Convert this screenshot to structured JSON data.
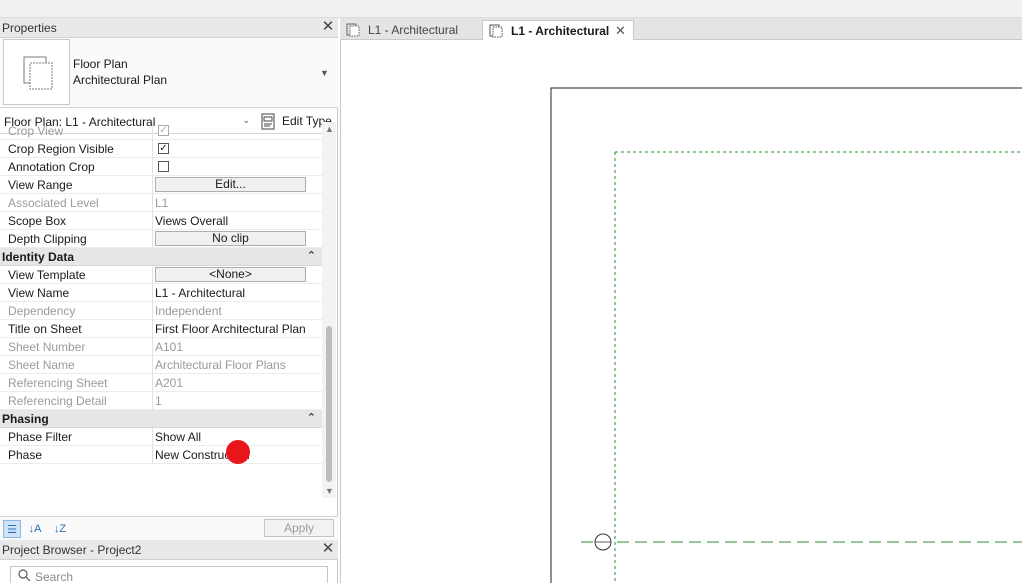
{
  "properties_panel": {
    "title": "Properties",
    "type_selector": {
      "family": "Floor Plan",
      "type": "Architectural Plan"
    },
    "instance_selector": "Floor Plan: L1 - Architectural",
    "edit_type_label": "Edit Type",
    "rows": {
      "crop_view": {
        "name": "Crop View"
      },
      "crop_region_visible": {
        "name": "Crop Region Visible"
      },
      "annotation_crop": {
        "name": "Annotation Crop"
      },
      "view_range": {
        "name": "View Range",
        "value": "Edit..."
      },
      "associated_level": {
        "name": "Associated Level",
        "value": "L1"
      },
      "scope_box": {
        "name": "Scope Box",
        "value": "Views Overall"
      },
      "depth_clipping": {
        "name": "Depth Clipping",
        "value": "No clip"
      },
      "view_template": {
        "name": "View Template",
        "value": "<None>"
      },
      "view_name": {
        "name": "View Name",
        "value": "L1 - Architectural"
      },
      "dependency": {
        "name": "Dependency",
        "value": "Independent"
      },
      "title_on_sheet": {
        "name": "Title on Sheet",
        "value": "First Floor Architectural Plan"
      },
      "sheet_number": {
        "name": "Sheet Number",
        "value": "A101"
      },
      "sheet_name": {
        "name": "Sheet Name",
        "value": "Architectural Floor Plans"
      },
      "referencing_sheet": {
        "name": "Referencing Sheet",
        "value": "A201"
      },
      "referencing_detail": {
        "name": "Referencing Detail",
        "value": "1"
      },
      "phase_filter": {
        "name": "Phase Filter",
        "value": "Show All"
      },
      "phase": {
        "name": "Phase",
        "value": "New Construction"
      }
    },
    "groups": {
      "identity_data": "Identity Data",
      "phasing": "Phasing"
    },
    "apply_label": "Apply"
  },
  "project_browser": {
    "title": "Project Browser - Project2",
    "search_placeholder": "Search"
  },
  "tabs": [
    {
      "label": "L1 - Architectural"
    },
    {
      "label": "L1 - Architectural"
    }
  ],
  "colors": {
    "crop_region_dashes": "#2e8b2e",
    "marker": "#e8151b",
    "accent": "#2c6fb7"
  }
}
